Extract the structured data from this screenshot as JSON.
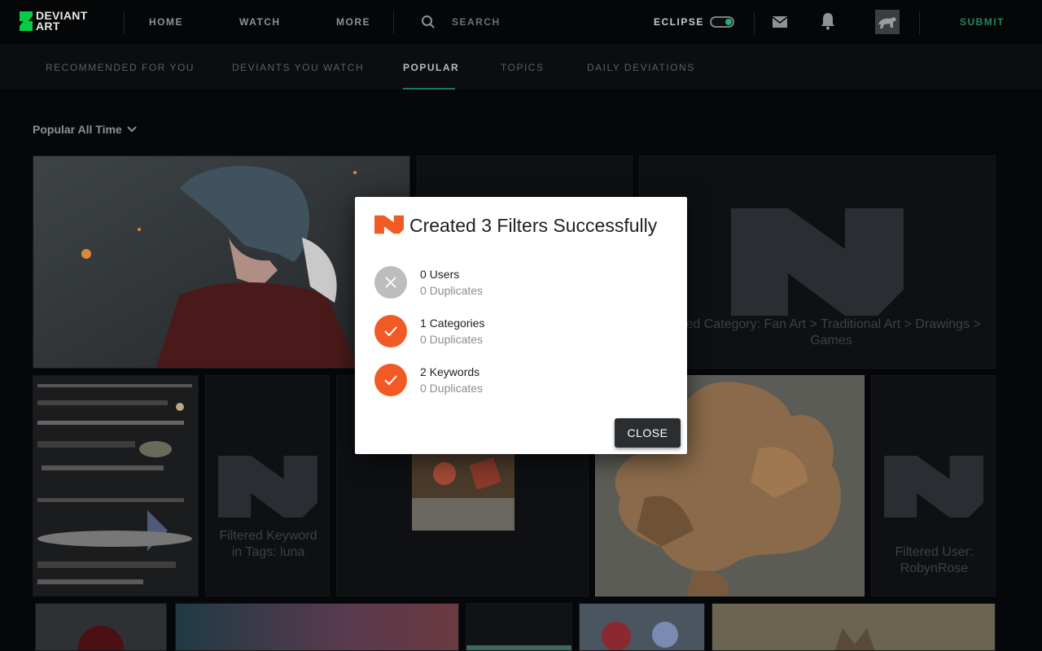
{
  "header": {
    "logo_line1": "DEVIANT",
    "logo_line2": "ART",
    "nav": [
      "HOME",
      "WATCH",
      "MORE"
    ],
    "search_label": "SEARCH",
    "eclipse_label": "ECLIPSE",
    "submit_label": "SUBMIT"
  },
  "subnav": {
    "items": [
      "RECOMMENDED FOR YOU",
      "DEVIANTS YOU WATCH",
      "POPULAR",
      "TOPICS",
      "DAILY DEVIATIONS"
    ],
    "active": "POPULAR"
  },
  "content": {
    "sort_label": "Popular All Time",
    "filtered_category": "red Category: Fan Art > Traditional Art > Drawings > Games",
    "filtered_keyword": "Filtered Keyword in Tags: luna",
    "filtered_user": "Filtered User: RobynRose"
  },
  "modal": {
    "title": "Created 3 Filters Successfully",
    "rows": [
      {
        "main": "0 Users",
        "sub": "0 Duplicates",
        "status": "none"
      },
      {
        "main": "1 Categories",
        "sub": "0 Duplicates",
        "status": "ok"
      },
      {
        "main": "2 Keywords",
        "sub": "0 Duplicates",
        "status": "ok"
      }
    ],
    "close_label": "CLOSE"
  },
  "colors": {
    "accent_green": "#1c8a5f",
    "modal_accent": "#f15a24"
  }
}
